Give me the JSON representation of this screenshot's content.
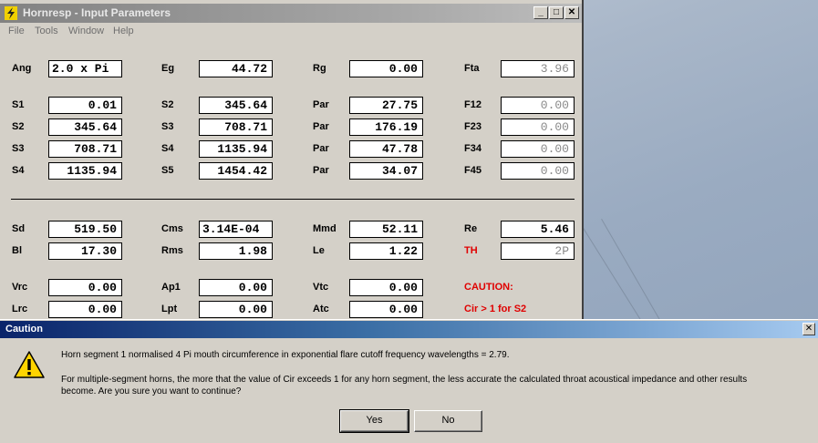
{
  "window": {
    "title": "Hornresp - Input Parameters",
    "menu": [
      "File",
      "Tools",
      "Window",
      "Help"
    ],
    "controls": {
      "minimize": "_",
      "maximize": "□",
      "close": "✕"
    }
  },
  "rows": {
    "r1": {
      "c1": {
        "label": "Ang",
        "value": "2.0 x Pi"
      },
      "c2": {
        "label": "Eg",
        "value": "44.72"
      },
      "c3": {
        "label": "Rg",
        "value": "0.00"
      },
      "c4": {
        "label": "Fta",
        "value": "3.96"
      }
    },
    "r2": {
      "c1": {
        "label": "S1",
        "value": "0.01"
      },
      "c2": {
        "label": "S2",
        "value": "345.64"
      },
      "c3": {
        "label": "Par",
        "value": "27.75"
      },
      "c4": {
        "label": "F12",
        "value": "0.00"
      }
    },
    "r3": {
      "c1": {
        "label": "S2",
        "value": "345.64"
      },
      "c2": {
        "label": "S3",
        "value": "708.71"
      },
      "c3": {
        "label": "Par",
        "value": "176.19"
      },
      "c4": {
        "label": "F23",
        "value": "0.00"
      }
    },
    "r4": {
      "c1": {
        "label": "S3",
        "value": "708.71"
      },
      "c2": {
        "label": "S4",
        "value": "1135.94"
      },
      "c3": {
        "label": "Par",
        "value": "47.78"
      },
      "c4": {
        "label": "F34",
        "value": "0.00"
      }
    },
    "r5": {
      "c1": {
        "label": "S4",
        "value": "1135.94"
      },
      "c2": {
        "label": "S5",
        "value": "1454.42"
      },
      "c3": {
        "label": "Par",
        "value": "34.07"
      },
      "c4": {
        "label": "F45",
        "value": "0.00"
      }
    },
    "r6": {
      "c1": {
        "label": "Sd",
        "value": "519.50"
      },
      "c2": {
        "label": "Cms",
        "value": "3.14E-04"
      },
      "c3": {
        "label": "Mmd",
        "value": "52.11"
      },
      "c4": {
        "label": "Re",
        "value": "5.46"
      }
    },
    "r7": {
      "c1": {
        "label": "Bl",
        "value": "17.30"
      },
      "c2": {
        "label": "Rms",
        "value": "1.98"
      },
      "c3": {
        "label": "Le",
        "value": "1.22"
      },
      "c4": {
        "label": "TH",
        "value": "2P"
      }
    },
    "r8": {
      "c1": {
        "label": "Vrc",
        "value": "0.00"
      },
      "c2": {
        "label": "Ap1",
        "value": "0.00"
      },
      "c3": {
        "label": "Vtc",
        "value": "0.00"
      },
      "c4": {
        "label": "CAUTION:"
      }
    },
    "r9": {
      "c1": {
        "label": "Lrc",
        "value": "0.00"
      },
      "c2": {
        "label": "Lpt",
        "value": "0.00"
      },
      "c3": {
        "label": "Atc",
        "value": "0.00"
      },
      "c4": {
        "label": "Cir > 1 for S2"
      }
    }
  },
  "dialog": {
    "title": "Caution",
    "close": "✕",
    "icon": "warning-icon",
    "line1": "Horn segment 1 normalised 4 Pi mouth circumference in exponential flare cutoff frequency wavelengths = 2.79.",
    "line2": "For multiple-segment horns, the more that the value of Cir exceeds 1 for any horn segment, the less accurate the calculated throat acoustical impedance and other results",
    "line3": "become.  Are you sure you want to continue?",
    "yes": "Yes",
    "no": "No"
  },
  "colors": {
    "warning_red": "#e00000",
    "dialog_title": "#0a246a",
    "readonly_text": "#8a8a8a"
  }
}
